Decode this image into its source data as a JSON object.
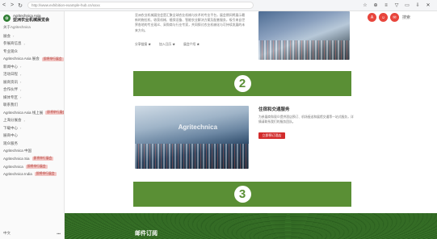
{
  "browser": {
    "back": "<",
    "forward": ">",
    "reload": "↻",
    "url": "http://www.exhibition-example-hub.cn/xxxx",
    "right_icons": [
      "☆",
      "⊕",
      "≡",
      "▽",
      "▭",
      "⇩",
      "✕"
    ]
  },
  "sidebar": {
    "logo_line1": "Agritechnica Asia",
    "logo_line2": "亚洲农业机械展览会",
    "subtitle": "关于Agritechnica",
    "items": [
      {
        "label": "展会",
        "chevron": true,
        "tag": ""
      },
      {
        "label": "参展商信息",
        "chevron": true,
        "tag": ""
      },
      {
        "label": "专业观众",
        "chevron": false,
        "tag": ""
      },
      {
        "label": "Agritechnica Asia 展会",
        "chevron": false,
        "tag": "即将举行展会"
      },
      {
        "label": "新闻中心",
        "chevron": true,
        "tag": ""
      },
      {
        "label": "活动日程",
        "chevron": true,
        "tag": ""
      },
      {
        "label": "展商资讯",
        "chevron": true,
        "tag": ""
      },
      {
        "label": "合作伙伴",
        "chevron": true,
        "tag": ""
      },
      {
        "label": "媒体专区",
        "chevron": true,
        "tag": ""
      },
      {
        "label": "联系我们",
        "chevron": false,
        "tag": ""
      },
      {
        "label": "Agritechnica Asia 线上展",
        "chevron": false,
        "tag": "即将举行展会"
      },
      {
        "label": "上海分展会",
        "chevron": true,
        "tag": ""
      },
      {
        "label": "下载中心",
        "chevron": true,
        "tag": ""
      },
      {
        "label": "展商中心",
        "chevron": false,
        "tag": ""
      },
      {
        "label": "观众服务",
        "chevron": false,
        "tag": ""
      },
      {
        "label": "Agritechnica 中国",
        "chevron": false,
        "tag": ""
      },
      {
        "label": "Agritechnica Sia",
        "chevron": false,
        "tag": "即将举行展会"
      },
      {
        "label": "Agritechnica",
        "chevron": false,
        "tag": "即将举行展会"
      },
      {
        "label": "Agritechnica India",
        "chevron": false,
        "tag": "即将举行展会"
      }
    ],
    "footer_left": "中文",
    "footer_right": "•••"
  },
  "fab": {
    "a": "A",
    "b": "☺",
    "c": "✉"
  },
  "search_label": "搜索",
  "article": {
    "body": "亚洲农业机械展览会是汇聚全球农业机械与技术的专业平台，展会期间将展示最新的拖拉机、收获机械、植保设备、智能农业解决方案及配套服务，吸引来自世界各地的专业观众、采购商与行业专家，共同探讨农业机械化与可持续发展的未来方向。",
    "meta": [
      "分享链接 ★",
      "加入日历 ★",
      "展会介绍 ★"
    ]
  },
  "steps": {
    "two": "2",
    "three": "3"
  },
  "section2": {
    "title": "住宿和交通服务",
    "desc": "为参展商和观众提供酒店预订、机场接送和展馆交通等一站式服务，详情请联系我们的服务团队。",
    "cta": "立即预订酒店"
  },
  "photo2_sign": "Agritechnica",
  "footer": {
    "title": "邮件订阅"
  }
}
